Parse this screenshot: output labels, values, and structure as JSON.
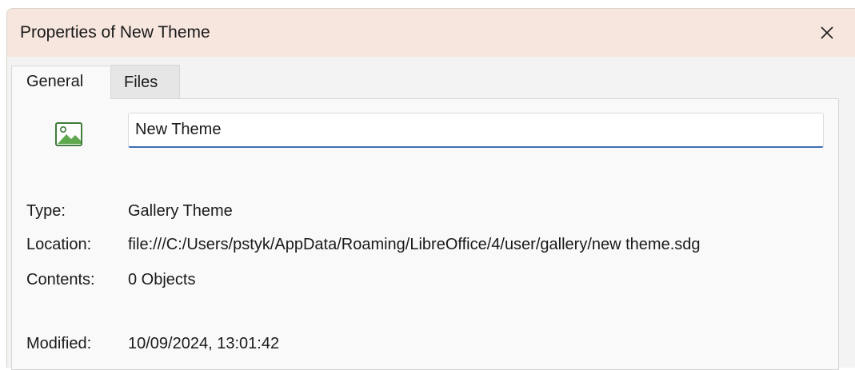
{
  "window": {
    "title": "Properties of New Theme",
    "close_icon": "close-icon"
  },
  "tabs": [
    {
      "label": "General",
      "selected": true
    },
    {
      "label": "Files",
      "selected": false
    }
  ],
  "general": {
    "theme_icon": "gallery-image-icon",
    "name_value": "New Theme",
    "type_label": "Type:",
    "type_value": "Gallery Theme",
    "location_label": "Location:",
    "location_value": "file:///C:/Users/pstyk/AppData/Roaming/LibreOffice/4/user/gallery/new theme.sdg",
    "contents_label": "Contents:",
    "contents_value": "0 Objects",
    "modified_label": "Modified:",
    "modified_value": "10/09/2024, 13:01:42"
  },
  "colors": {
    "titlebar_bg": "#f6e6de",
    "dialog_bg": "#f3f3f3",
    "input_focus_underline": "#3d6fb5"
  }
}
